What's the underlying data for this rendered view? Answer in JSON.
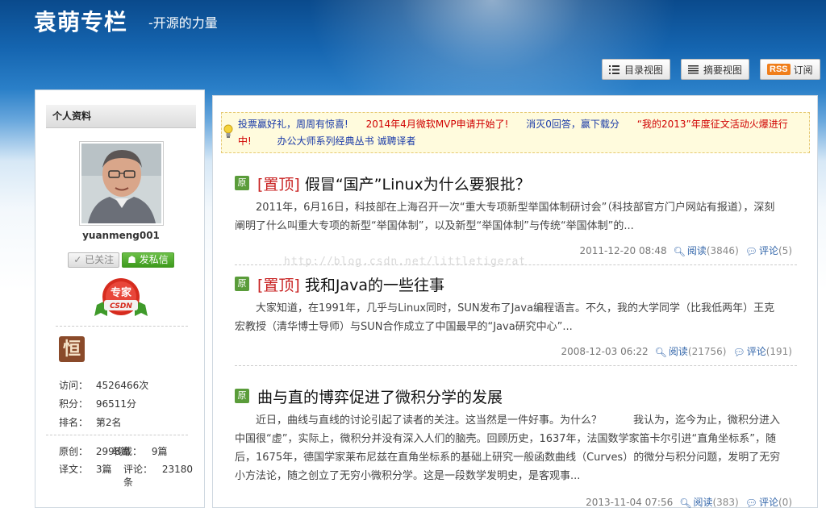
{
  "header": {
    "title": "袁萌专栏",
    "subtitle": "-开源的力量",
    "catalog_view": "目录视图",
    "summary_view": "摘要视图",
    "rss_badge": "RSS",
    "subscribe": "订阅"
  },
  "sidebar": {
    "panel_title": "个人资料",
    "username": "yuanmeng001",
    "follow_button": "已关注",
    "message_button": "发私信",
    "badge_top": "专家",
    "badge_bottom": "CSDN",
    "medal_char": "恒",
    "stats": {
      "visits_label": "访问：",
      "visits_value": "4526466次",
      "points_label": "积分：",
      "points_value": "96511分",
      "rank_label": "排名：",
      "rank_value": "第2名",
      "original_label": "原创：",
      "original_value": "2998篇",
      "repost_label": "转载：",
      "repost_value": "9篇",
      "translation_label": "译文：",
      "translation_value": "3篇",
      "comments_label": "评论：",
      "comments_value": "23180",
      "comments_unit": "条"
    }
  },
  "notice": {
    "items": [
      {
        "text": "投票赢好礼，周周有惊喜!",
        "color": "blue"
      },
      {
        "text": "2014年4月微软MVP申请开始了!",
        "color": "red"
      },
      {
        "text": "消灭0回答，赢下载分",
        "color": "blue"
      },
      {
        "text": "“我的2013”年度征文活动火爆进行中!",
        "color": "red"
      },
      {
        "text": "办公大师系列经典丛书 诚聘译者",
        "color": "blue"
      }
    ]
  },
  "articles": [
    {
      "orig_label": "原",
      "top_tag": "[置顶]",
      "title": "假冒“国产”Linux为什么要狠批？",
      "summary": "2011年，6月16日，科技部在上海召开一次“重大专项新型举国体制研讨会”（科技部官方门户网站有报道），深刻阐明了什么叫重大专项的新型“举国体制”，以及新型“举国体制”与传统“举国体制”的...",
      "date": "2011-12-20 08:48",
      "reads_label": "阅读",
      "reads": "(3846)",
      "comments_label": "评论",
      "comments": "(5)"
    },
    {
      "orig_label": "原",
      "top_tag": "[置顶]",
      "title": "我和Java的一些往事",
      "summary": "大家知道，在1991年，几乎与Linux同时，SUN发布了Java编程语言。不久，我的大学同学（比我低两年）王克宏教授（清华博士导师）与SUN合作成立了中国最早的“Java研究中心”...",
      "date": "2008-12-03 06:22",
      "reads_label": "阅读",
      "reads": "(21756)",
      "comments_label": "评论",
      "comments": "(191)"
    },
    {
      "orig_label": "原",
      "top_tag": "",
      "title": "曲与直的博弈促进了微积分学的发展",
      "summary": "近日，曲线与直线的讨论引起了读者的关注。这当然是一件好事。为什么？　　　我认为，迄今为止，微积分进入中国很“虚”，实际上，微积分并没有深入人们的脑壳。回顾历史，1637年，法国数学家笛卡尔引进“直角坐标系”，随后，1675年，德国学家莱布尼兹在直角坐标系的基础上研究一般函数曲线（Curves）的微分与积分问题，发明了无穷小方法论，随之创立了无穷小微积分学。这是一段数学发明史，是客观事...",
      "date": "2013-11-04 07:56",
      "reads_label": "阅读",
      "reads": "(383)",
      "comments_label": "评论",
      "comments": "(0)"
    }
  ],
  "watermark": "http://blog.csdn.net/littletigerat"
}
